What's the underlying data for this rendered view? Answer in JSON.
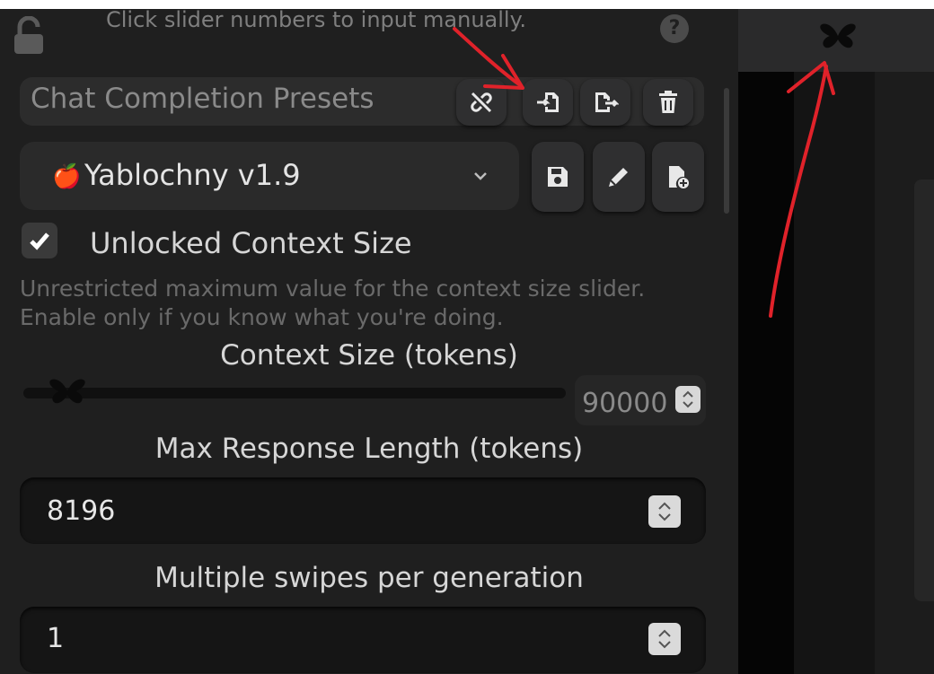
{
  "hint": "Click slider numbers to input manually.",
  "help_label": "?",
  "presets": {
    "title": "Chat Completion Presets",
    "buttons": [
      "unlink-icon",
      "import-icon",
      "export-icon",
      "trash-icon"
    ]
  },
  "preset_select": {
    "icon": "🍎",
    "selected": "Yablochny v1.9",
    "buttons": [
      "save-icon",
      "pencil-icon",
      "new-file-icon"
    ]
  },
  "unlocked": {
    "label": "Unlocked Context Size",
    "checked": true,
    "description": "Unrestricted maximum value for the context size slider. Enable only if you know what you're doing."
  },
  "context_size": {
    "label": "Context Size (tokens)",
    "value": "90000"
  },
  "max_response": {
    "label": "Max Response Length (tokens)",
    "value": "8196"
  },
  "swipes": {
    "label": "Multiple swipes per generation",
    "value": "1"
  },
  "colors": {
    "panel": "#1f1f1f",
    "annotation": "#e0222a"
  }
}
